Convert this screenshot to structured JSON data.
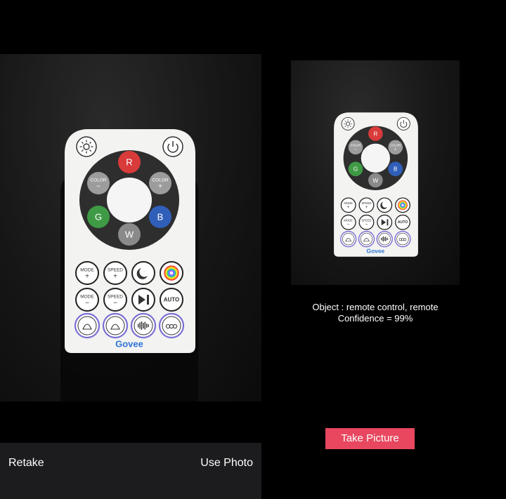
{
  "photo_view": {
    "retake_label": "Retake",
    "use_photo_label": "Use Photo"
  },
  "remote": {
    "brand": "Govee",
    "ring_buttons": {
      "red": "R",
      "green": "G",
      "blue": "B",
      "white": "W",
      "color_minus": "COLOR",
      "color_plus": "COLOR"
    },
    "row1": [
      "MODE",
      "SPEED",
      "",
      ""
    ],
    "row2": [
      "MODE",
      "SPEED",
      "",
      "AUTO"
    ],
    "colors": {
      "red": "#d93a3a",
      "green": "#3f9a45",
      "blue": "#2f5fb8",
      "white": "#8a8a8a",
      "grey": "#9c9c9c",
      "ring": "#2e2e2e",
      "brand": "#2d73d8"
    }
  },
  "recognition": {
    "object_text": "Object : remote control, remote",
    "confidence_text": "Confidence = 99%"
  },
  "actions": {
    "take_picture_label": "Take Picture"
  }
}
